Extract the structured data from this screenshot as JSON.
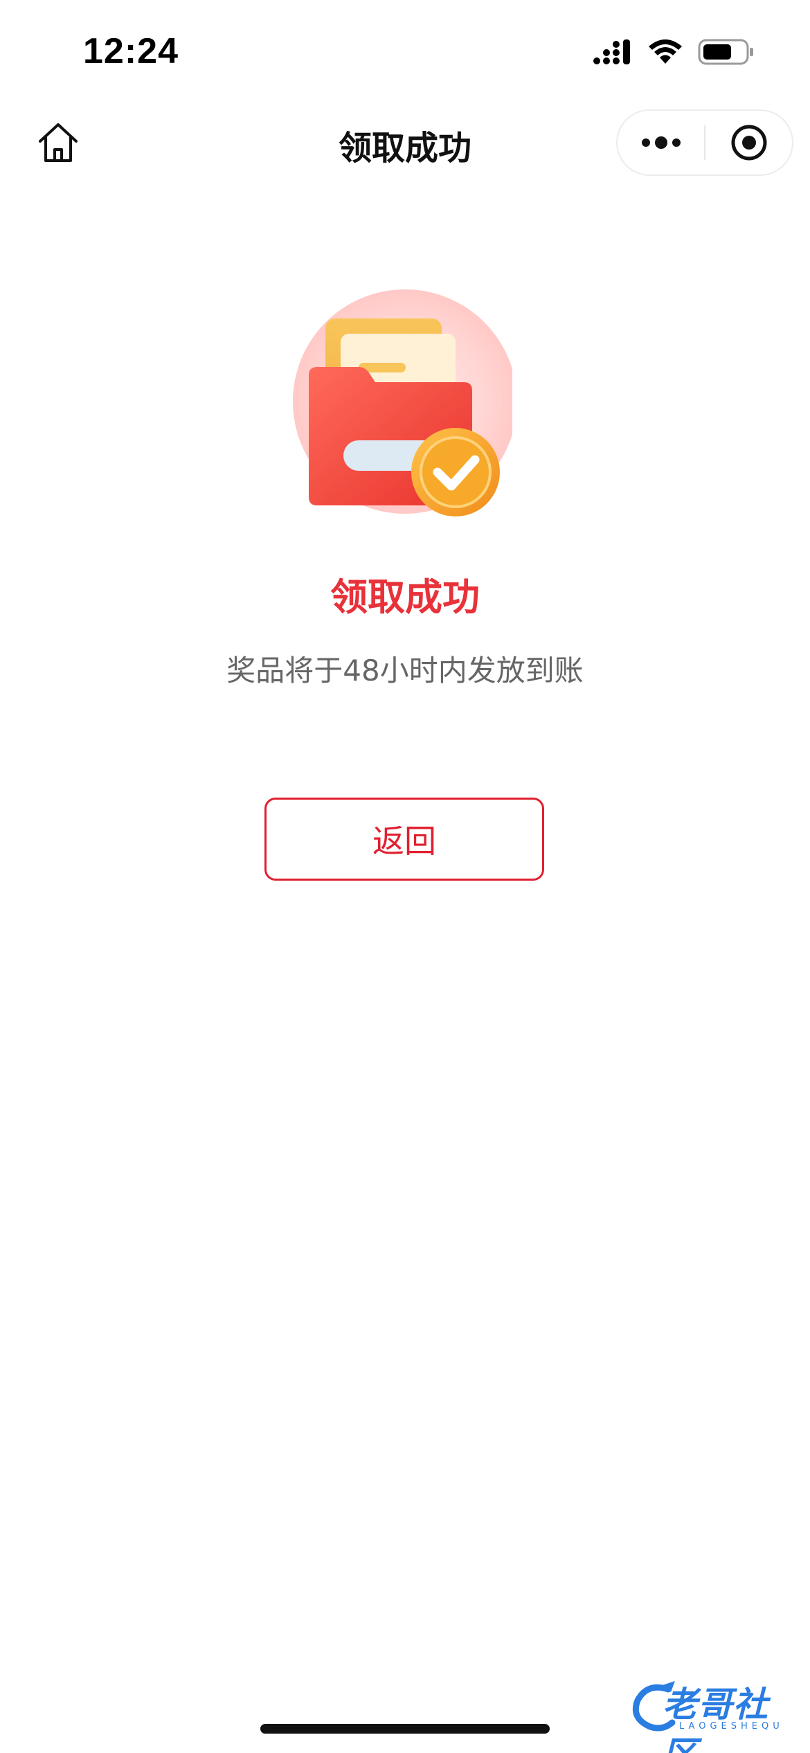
{
  "status_bar": {
    "time": "12:24",
    "icons": [
      "cellular-signal-icon",
      "wifi-icon",
      "battery-icon"
    ]
  },
  "nav": {
    "title": "领取成功",
    "home_icon": "home-icon",
    "more_icon": "more-dots-icon",
    "close_icon": "target-close-icon"
  },
  "result": {
    "illustration": "folder-check-illustration",
    "title": "领取成功",
    "subtitle": "奖品将于48小时内发放到账"
  },
  "actions": {
    "back_label": "返回"
  },
  "watermark": {
    "text": "老哥社区",
    "subtext": "LAOGESHEQU"
  },
  "colors": {
    "accent_red": "#e8323a",
    "button_red": "#e02030",
    "subtitle_gray": "#666666",
    "folder_red": "#f0524a",
    "check_orange": "#f5a623",
    "watermark_blue": "#2a7de1"
  }
}
